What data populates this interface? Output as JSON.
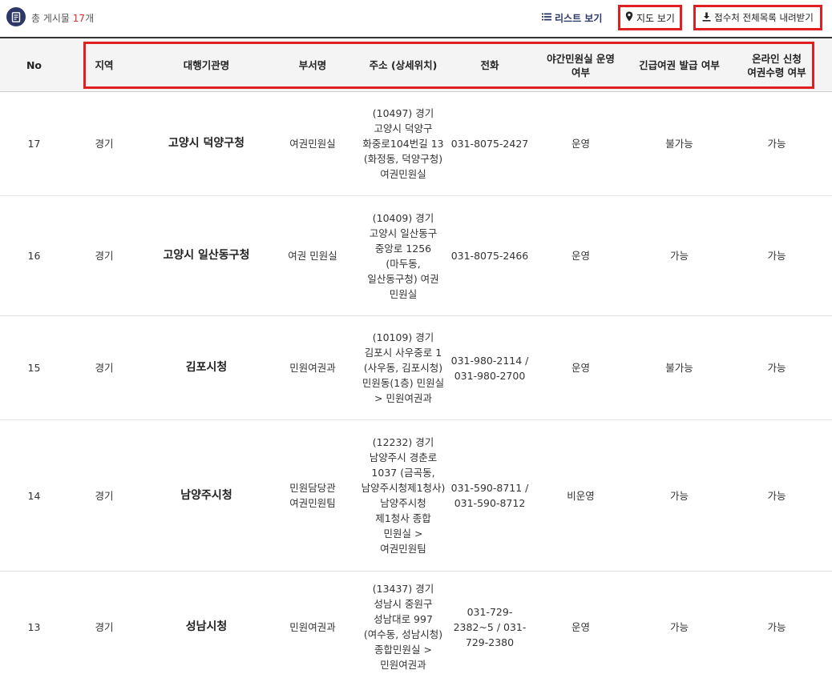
{
  "summary": {
    "prefix": "총 게시물 ",
    "count": "17",
    "suffix": "개"
  },
  "actions": {
    "list_view": "리스트 보기",
    "map_view": "지도 보기",
    "download": "접수처 전체목록 내려받기"
  },
  "icons": {
    "summary": "document-icon",
    "list": "list-icon",
    "map": "map-pin-icon",
    "download": "download-icon"
  },
  "colors": {
    "brand": "#2c3868",
    "highlight": "#e02020",
    "count": "#d32f2f",
    "header_bg": "#f4f4f4"
  },
  "table": {
    "headers": {
      "no": "No",
      "region": "지역",
      "agency": "대행기관명",
      "dept": "부서명",
      "address": "주소 (상세위치)",
      "phone": "전화",
      "night": "야간민원실 운영\n여부",
      "emergency": "긴급여권 발급 여부",
      "online": "온라인 신청\n여권수령 여부"
    },
    "rows": [
      {
        "no": "17",
        "region": "경기",
        "agency": "고양시 덕양구청",
        "dept": "여권민원실",
        "address": "(10497) 경기\n고양시 덕양구\n화중로104번길 13\n(화정동, 덕양구청)\n여권민원실",
        "phone": "031-8075-2427",
        "night": "운영",
        "emergency": "불가능",
        "online": "가능"
      },
      {
        "no": "16",
        "region": "경기",
        "agency": "고양시 일산동구청",
        "dept": "여권 민원실",
        "address": "(10409) 경기\n고양시 일산동구\n중앙로 1256\n(마두동,\n일산동구청) 여권\n민원실",
        "phone": "031-8075-2466",
        "night": "운영",
        "emergency": "가능",
        "online": "가능"
      },
      {
        "no": "15",
        "region": "경기",
        "agency": "김포시청",
        "dept": "민원여권과",
        "address": "(10109) 경기\n김포시 사우중로 1\n(사우동, 김포시청)\n민원동(1층) 민원실\n> 민원여권과",
        "phone": "031-980-2114 /\n031-980-2700",
        "night": "운영",
        "emergency": "불가능",
        "online": "가능"
      },
      {
        "no": "14",
        "region": "경기",
        "agency": "남양주시청",
        "dept": "민원담당관\n여권민원팀",
        "address": "(12232) 경기\n남양주시 경춘로\n1037 (금곡동,\n남양주시청제1청사)\n남양주시청\n제1청사 종합\n민원실 >\n여권민원팀",
        "phone": "031-590-8711 /\n031-590-8712",
        "night": "비운영",
        "emergency": "가능",
        "online": "가능"
      },
      {
        "no": "13",
        "region": "경기",
        "agency": "성남시청",
        "dept": "민원여권과",
        "address": "(13437) 경기\n성남시 중원구\n성남대로 997\n(여수동, 성남시청)\n종합민원실 >\n민원여권과",
        "phone": "031-729-\n2382~5 / 031-\n729-2380",
        "night": "운영",
        "emergency": "가능",
        "online": "가능"
      }
    ]
  }
}
